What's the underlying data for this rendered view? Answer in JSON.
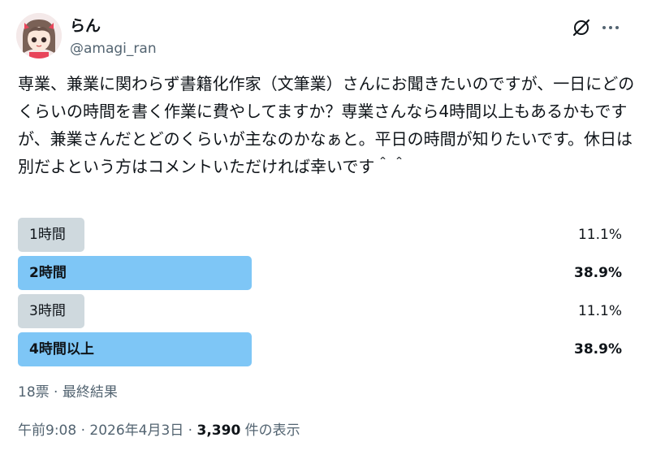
{
  "user": {
    "display_name": "らん",
    "handle": "@amagi_ran"
  },
  "icons": {
    "avatar": "avatar",
    "grok": "grok-icon",
    "more": "more-icon"
  },
  "tweet": {
    "text": "専業、兼業に関わらず書籍化作家（文筆業）さんにお聞きたいのですが、一日にどのくらいの時間を書く作業に費やしてますか？専業さんなら4時間以上もあるかもですが、兼業さんだとどのくらいが主なのかなぁと。平日の時間が知りたいです。休日は別だよという方はコメントいただければ幸いです＾＾"
  },
  "poll": {
    "options": [
      {
        "label": "1時間",
        "percent": "11.1%",
        "value": 11.1,
        "leading": false
      },
      {
        "label": "2時間",
        "percent": "38.9%",
        "value": 38.9,
        "leading": true
      },
      {
        "label": "3時間",
        "percent": "11.1%",
        "value": 11.1,
        "leading": false
      },
      {
        "label": "4時間以上",
        "percent": "38.9%",
        "value": 38.9,
        "leading": true
      }
    ],
    "summary": "18票 · 最終結果"
  },
  "meta": {
    "time_date": "午前9:08 · 2026年4月3日 · ",
    "views_count": "3,390",
    "views_label": " 件の表示"
  },
  "colors": {
    "leading_bar": "#7ec6f6",
    "other_bar": "#cfd9de",
    "secondary_text": "#536471",
    "primary_text": "#0f1419"
  }
}
